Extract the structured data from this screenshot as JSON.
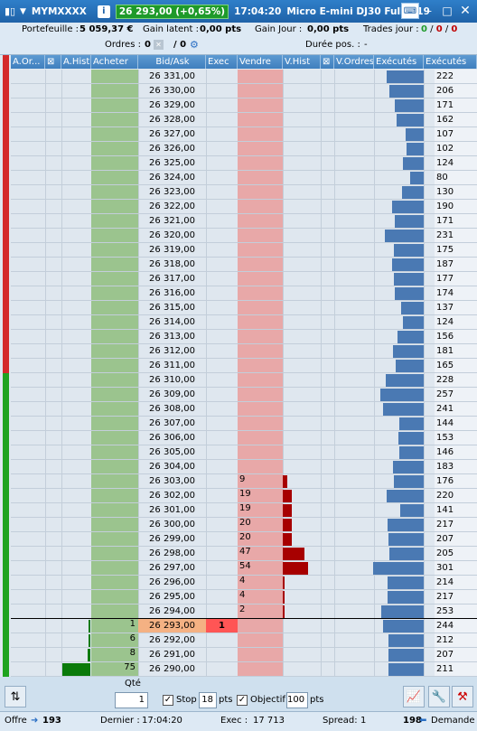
{
  "titlebar": {
    "symbol": "MYMXXXX",
    "info_label": "i",
    "quote": "26 293,00 (+0,65%)",
    "time": "17:04:20",
    "instrument": "Micro E-mini DJ30 Full0919"
  },
  "info": {
    "portefeuille_label": "Portefeuille :",
    "portefeuille_value": "5 059,37 €",
    "gain_latent_label": "Gain latent :",
    "gain_latent_value": "0,00 pts",
    "gain_jour_label": "Gain Jour :",
    "gain_jour_value": "0,00 pts",
    "trades_label": "Trades jour :",
    "trades_a": "0",
    "trades_b": "0",
    "trades_c": "0",
    "ordres_label": "Ordres :",
    "ordres_a": "0",
    "ordres_b": "/ 0",
    "duree_label": "Durée pos. :",
    "duree_value": "-"
  },
  "headers": {
    "a_ordres": "A.Or...",
    "a_hist": "A.Hist",
    "acheter": "Acheter",
    "bid_ask": "Bid/Ask",
    "exec": "Exec",
    "vendre": "Vendre",
    "v_hist": "V.Hist",
    "v_ordres": "V.Ordres",
    "executes1": "Exécutés",
    "executes2": "Exécutés"
  },
  "ladder": [
    {
      "price": "26 331,00",
      "executes": 222
    },
    {
      "price": "26 330,00",
      "executes": 206
    },
    {
      "price": "26 329,00",
      "executes": 171
    },
    {
      "price": "26 328,00",
      "executes": 162
    },
    {
      "price": "26 327,00",
      "executes": 107
    },
    {
      "price": "26 326,00",
      "executes": 102
    },
    {
      "price": "26 325,00",
      "executes": 124
    },
    {
      "price": "26 324,00",
      "executes": 80
    },
    {
      "price": "26 323,00",
      "executes": 130
    },
    {
      "price": "26 322,00",
      "executes": 190
    },
    {
      "price": "26 321,00",
      "executes": 171
    },
    {
      "price": "26 320,00",
      "executes": 231
    },
    {
      "price": "26 319,00",
      "executes": 175
    },
    {
      "price": "26 318,00",
      "executes": 187
    },
    {
      "price": "26 317,00",
      "executes": 177
    },
    {
      "price": "26 316,00",
      "executes": 174
    },
    {
      "price": "26 315,00",
      "executes": 137
    },
    {
      "price": "26 314,00",
      "executes": 124
    },
    {
      "price": "26 313,00",
      "executes": 156
    },
    {
      "price": "26 312,00",
      "executes": 181
    },
    {
      "price": "26 311,00",
      "executes": 165
    },
    {
      "price": "26 310,00",
      "executes": 228
    },
    {
      "price": "26 309,00",
      "executes": 257
    },
    {
      "price": "26 308,00",
      "executes": 241
    },
    {
      "price": "26 307,00",
      "executes": 144
    },
    {
      "price": "26 306,00",
      "executes": 153
    },
    {
      "price": "26 305,00",
      "executes": 146
    },
    {
      "price": "26 304,00",
      "executes": 183
    },
    {
      "price": "26 303,00",
      "executes": 176,
      "sell": "9",
      "vhist": 9
    },
    {
      "price": "26 302,00",
      "executes": 220,
      "sell": "19",
      "vhist": 19
    },
    {
      "price": "26 301,00",
      "executes": 141,
      "sell": "19",
      "vhist": 19
    },
    {
      "price": "26 300,00",
      "executes": 217,
      "sell": "20",
      "vhist": 20
    },
    {
      "price": "26 299,00",
      "executes": 207,
      "sell": "20",
      "vhist": 20
    },
    {
      "price": "26 298,00",
      "executes": 205,
      "sell": "47",
      "vhist": 47
    },
    {
      "price": "26 297,00",
      "executes": 301,
      "sell": "54",
      "vhist": 54
    },
    {
      "price": "26 296,00",
      "executes": 214,
      "sell": "4",
      "vhist": 4
    },
    {
      "price": "26 295,00",
      "executes": 217,
      "sell": "4",
      "vhist": 4
    },
    {
      "price": "26 294,00",
      "executes": 253,
      "sell": "2",
      "vhist": 2
    },
    {
      "price": "26 293,00",
      "executes": 244,
      "buy": "1",
      "ahist": 1,
      "exec": "1",
      "last": true
    },
    {
      "price": "26 292,00",
      "executes": 212,
      "buy": "6",
      "ahist": 6
    },
    {
      "price": "26 291,00",
      "executes": 207,
      "buy": "8",
      "ahist": 8
    },
    {
      "price": "26 290,00",
      "executes": 211,
      "buy": "75",
      "ahist": 75
    }
  ],
  "orderbar": {
    "qte_label": "Qté",
    "qte_value": "1",
    "stop_label": "Stop",
    "stop_value": "18",
    "stop_unit": "pts",
    "objectif_label": "Objectif",
    "objectif_value": "100",
    "objectif_unit": "pts"
  },
  "status": {
    "offre_label": "Offre",
    "offre_value": "193",
    "dernier_label": "Dernier :",
    "dernier_value": "17:04:20",
    "exec_label": "Exec :",
    "exec_value": "17 713",
    "spread_label": "Spread:",
    "spread_value": "1",
    "demande_value": "198",
    "demande_label": "Demande"
  },
  "colors": {
    "title_blue": "#1f62a8",
    "quote_green": "#1e9a2a",
    "buy_green": "#9bc48e",
    "sell_red": "#e8a8a8",
    "exec_blue": "#4a79b3",
    "vhist_red": "#a70000",
    "ahist_green": "#0a7a0a",
    "last_price_orange": "#f4b183",
    "exec_cell_red": "#ff5555"
  }
}
